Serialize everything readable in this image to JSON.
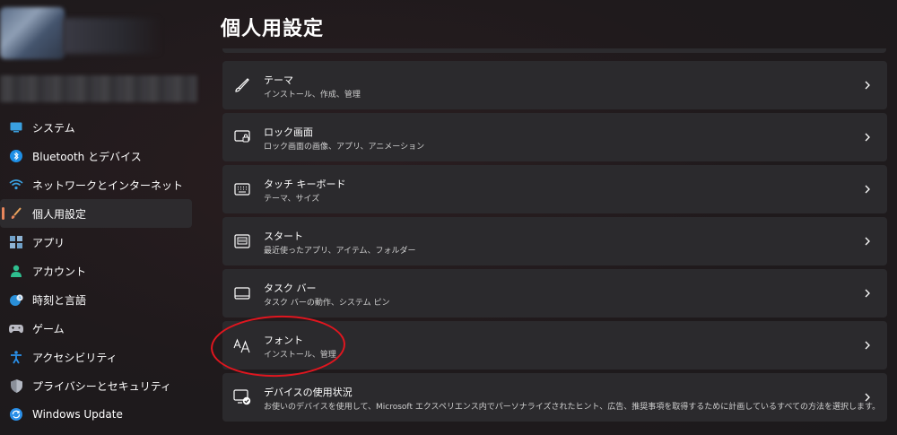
{
  "colors": {
    "accent": "#e8865c",
    "highlight": "#e0161f",
    "card_bg": "#2b2a2d"
  },
  "sidebar": {
    "items": [
      {
        "label": "システム",
        "icon": "monitor-icon"
      },
      {
        "label": "Bluetooth とデバイス",
        "icon": "bluetooth-icon"
      },
      {
        "label": "ネットワークとインターネット",
        "icon": "wifi-icon"
      },
      {
        "label": "個人用設定",
        "icon": "brush-icon",
        "active": true
      },
      {
        "label": "アプリ",
        "icon": "apps-icon"
      },
      {
        "label": "アカウント",
        "icon": "person-icon"
      },
      {
        "label": "時刻と言語",
        "icon": "globe-clock-icon"
      },
      {
        "label": "ゲーム",
        "icon": "gamepad-icon"
      },
      {
        "label": "アクセシビリティ",
        "icon": "accessibility-icon"
      },
      {
        "label": "プライバシーとセキュリティ",
        "icon": "shield-icon"
      },
      {
        "label": "Windows Update",
        "icon": "update-icon"
      }
    ]
  },
  "main": {
    "title": "個人用設定",
    "cards": [
      {
        "title": "テーマ",
        "subtitle": "インストール、作成、管理",
        "icon": "pen-icon"
      },
      {
        "title": "ロック画面",
        "subtitle": "ロック画面の画像、アプリ、アニメーション",
        "icon": "lock-screen-icon"
      },
      {
        "title": "タッチ キーボード",
        "subtitle": "テーマ、サイズ",
        "icon": "keyboard-icon"
      },
      {
        "title": "スタート",
        "subtitle": "最近使ったアプリ、アイテム、フォルダー",
        "icon": "start-icon"
      },
      {
        "title": "タスク バー",
        "subtitle": "タスク バーの動作、システム ピン",
        "icon": "taskbar-icon"
      },
      {
        "title": "フォント",
        "subtitle": "インストール、管理",
        "icon": "font-icon",
        "highlighted": true
      },
      {
        "title": "デバイスの使用状況",
        "subtitle": "お使いのデバイスを使用して、Microsoft エクスペリエンス内でパーソナライズされたヒント、広告、推奨事項を取得するために計画しているすべての方法を選択します。",
        "icon": "device-usage-icon"
      }
    ]
  }
}
